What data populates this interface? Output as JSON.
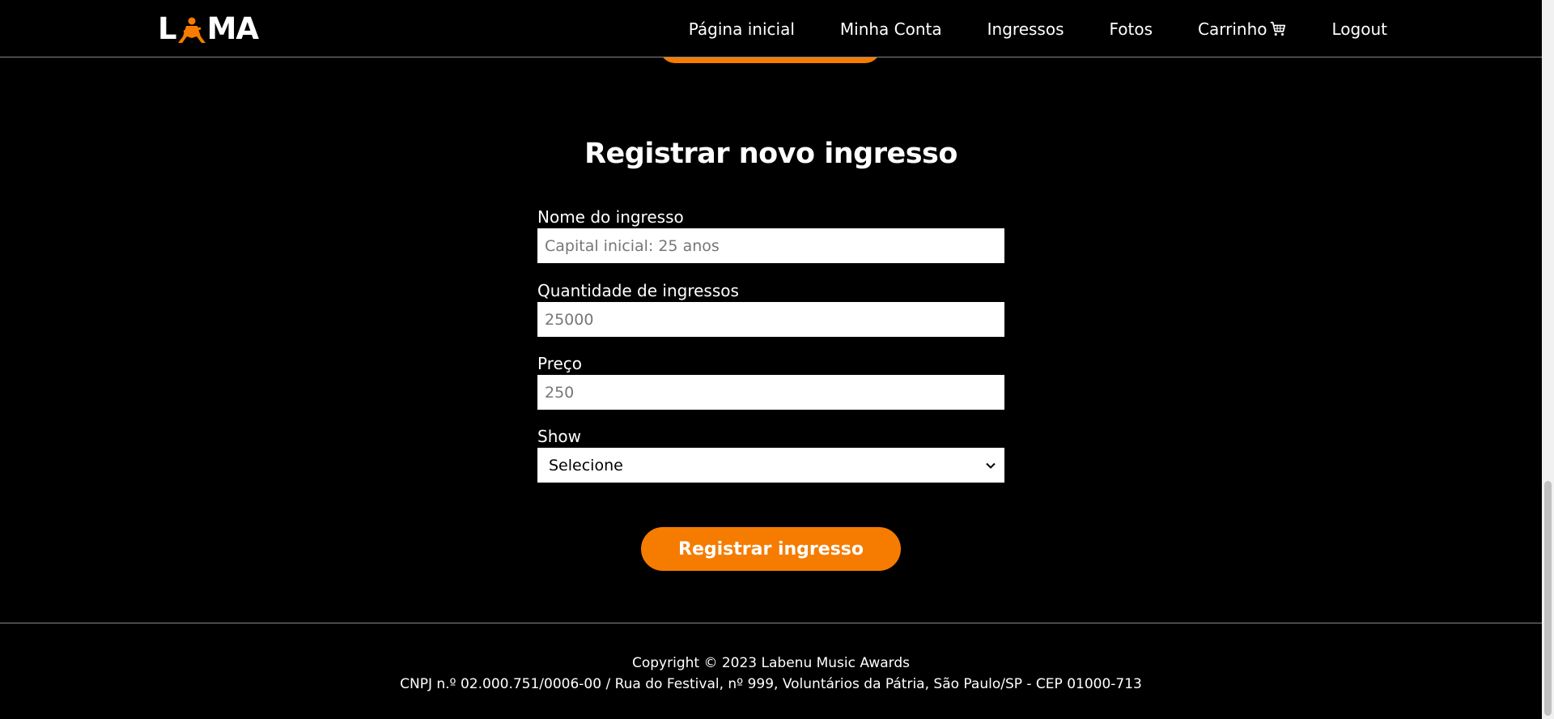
{
  "header": {
    "logo_text": "LAMA",
    "nav": [
      {
        "label": "Página inicial"
      },
      {
        "label": "Minha Conta"
      },
      {
        "label": "Ingressos"
      },
      {
        "label": "Fotos"
      },
      {
        "label": "Carrinho"
      },
      {
        "label": "Logout"
      }
    ]
  },
  "form": {
    "title": "Registrar novo ingresso",
    "name_label": "Nome do ingresso",
    "name_placeholder": "Capital inicial: 25 anos",
    "quantity_label": "Quantidade de ingressos",
    "quantity_placeholder": "25000",
    "price_label": "Preço",
    "price_placeholder": "250",
    "show_label": "Show",
    "show_selected": "Selecione",
    "submit_label": "Registrar ingresso"
  },
  "footer": {
    "copyright": "Copyright © 2023 Labenu Music Awards",
    "address": "CNPJ n.º 02.000.751/0006-00 / Rua do Festival, nº 999, Voluntários da Pátria, São Paulo/SP - CEP 01000-713"
  },
  "colors": {
    "background": "#000000",
    "accent": "#f57c00",
    "text": "#ffffff"
  },
  "icons": {
    "logo_mark": "guitarist-icon",
    "cart": "cart-icon",
    "select_arrow": "chevron-down-icon"
  }
}
